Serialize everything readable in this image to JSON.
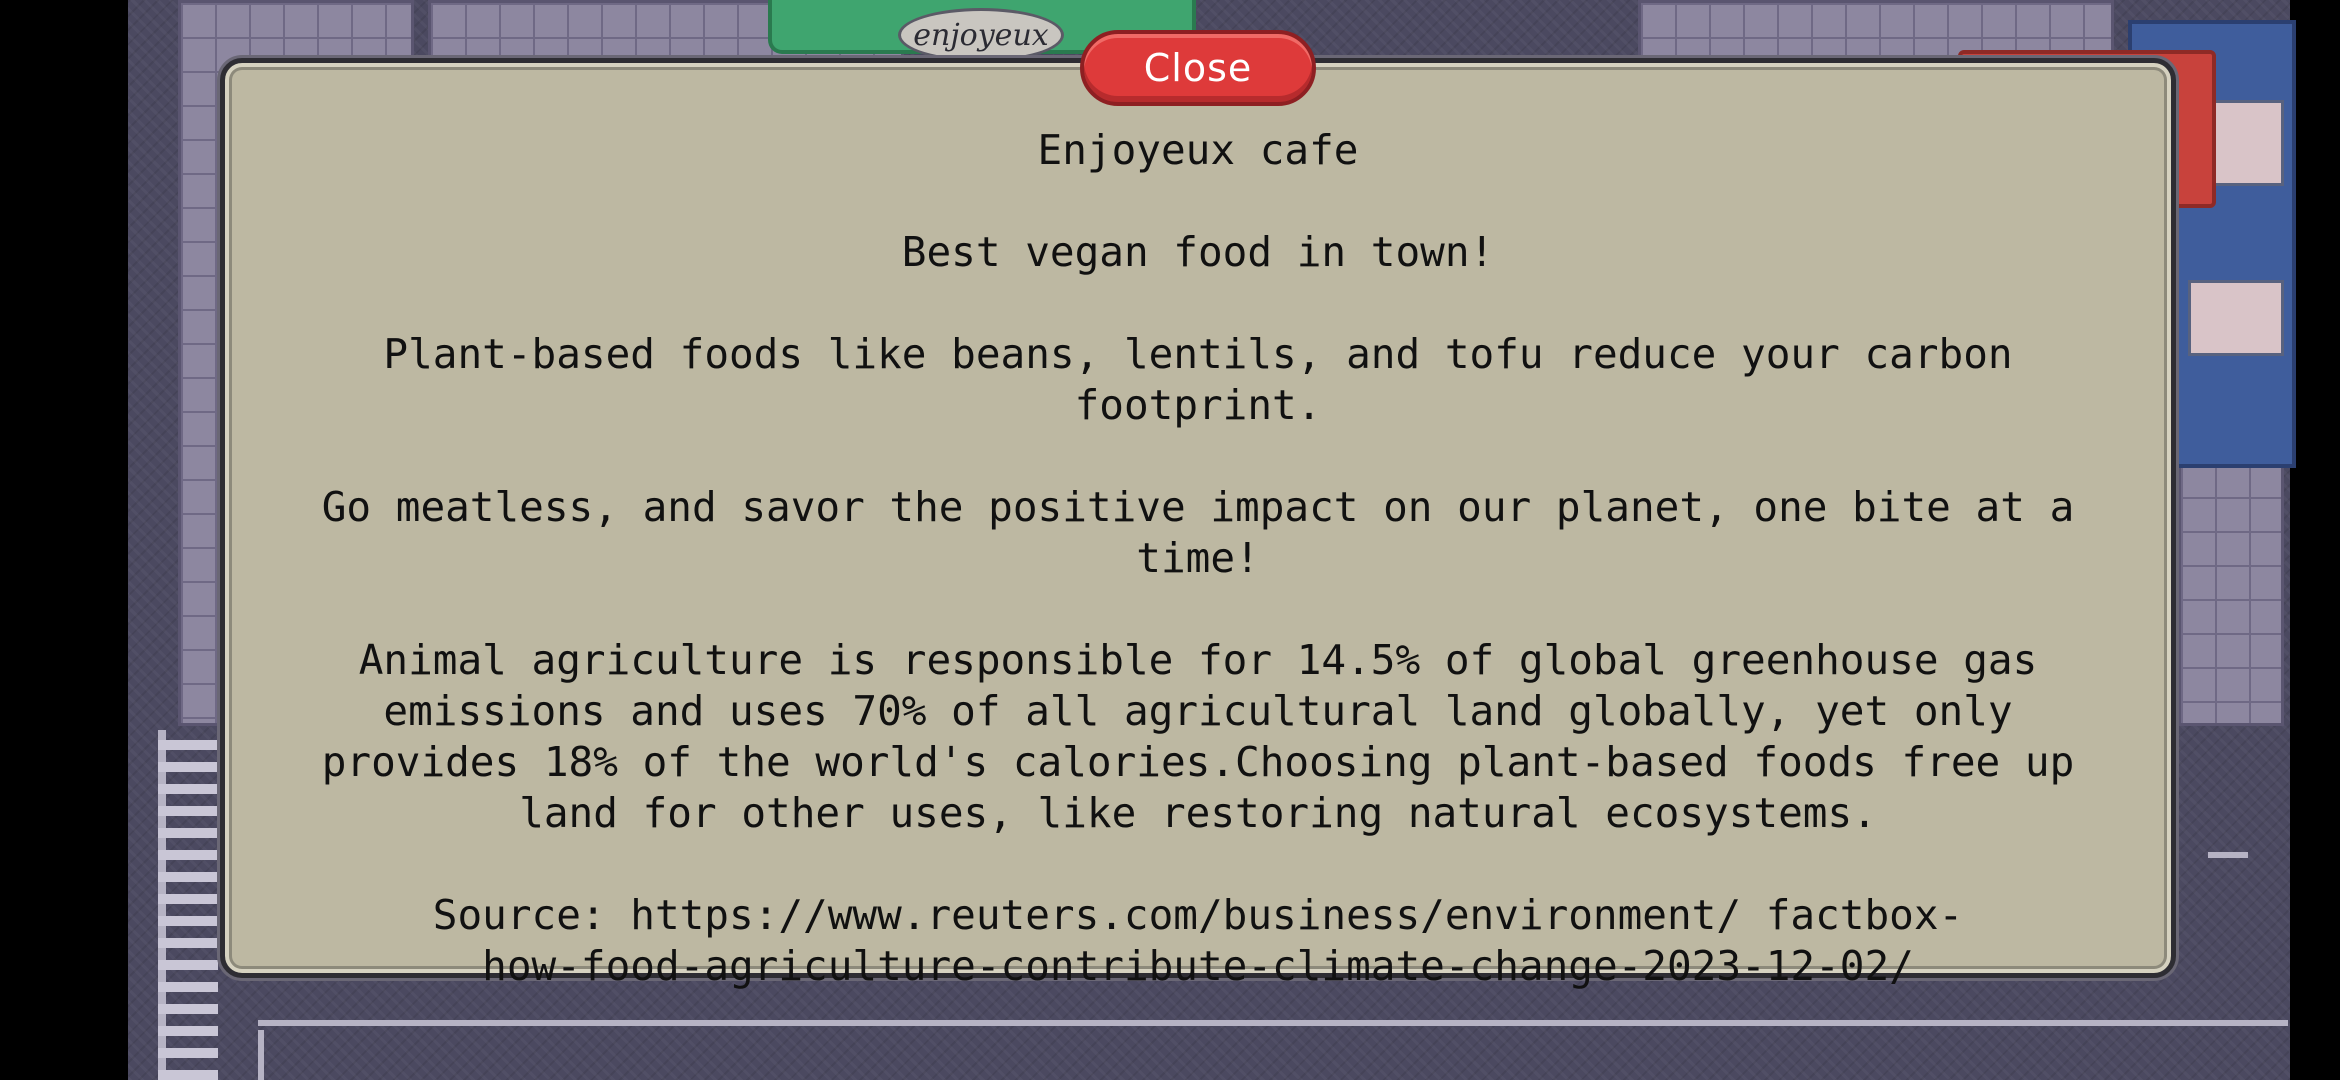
{
  "game": {
    "cafe_sign_text": "enjoyeux"
  },
  "dialog": {
    "close_label": "Close",
    "title": "Enjoyeux cafe",
    "tagline": "Best vegan food in town!",
    "paragraph_1": "Plant-based foods like beans, lentils, and tofu reduce your carbon footprint.",
    "paragraph_2": "Go meatless, and savor the positive impact on our planet, one bite at a time!",
    "paragraph_3": "Animal agriculture is responsible for 14.5% of global greenhouse gas emissions and uses 70% of all agricultural land globally, yet only provides 18% of the world's calories.Choosing plant-based foods free up land for other uses, like restoring natural ecosystems.",
    "source": "Source: https://www.reuters.com/business/environment/ factbox-how-food-agriculture-contribute-climate-change-2023-12-02/"
  },
  "colors": {
    "dialog_bg": "#bdb8a2",
    "close_button": "#de3a3a",
    "text": "#111111"
  }
}
